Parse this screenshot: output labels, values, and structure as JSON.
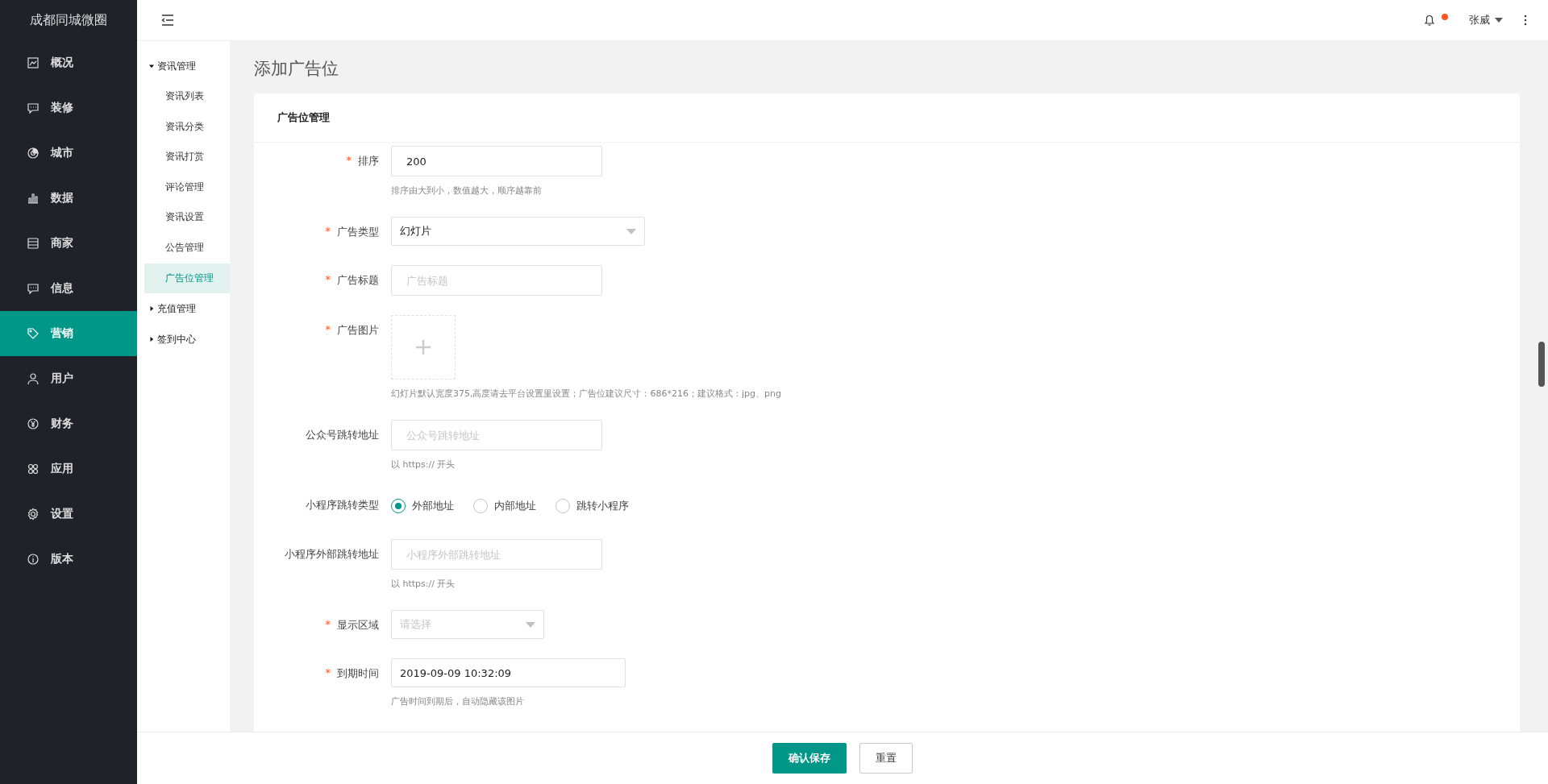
{
  "app": {
    "title": "成都同城微圈"
  },
  "sidebar": {
    "items": [
      {
        "label": "概况",
        "selected": false
      },
      {
        "label": "装修",
        "selected": false
      },
      {
        "label": "城市",
        "selected": false
      },
      {
        "label": "数据",
        "selected": false
      },
      {
        "label": "商家",
        "selected": false
      },
      {
        "label": "信息",
        "selected": false
      },
      {
        "label": "营销",
        "selected": true
      },
      {
        "label": "用户",
        "selected": false
      },
      {
        "label": "财务",
        "selected": false
      },
      {
        "label": "应用",
        "selected": false
      },
      {
        "label": "设置",
        "selected": false
      },
      {
        "label": "版本",
        "selected": false
      }
    ]
  },
  "topbar": {
    "has_unread": true,
    "user": "张威"
  },
  "submenu": {
    "groups": [
      {
        "label": "资讯管理",
        "expanded": true,
        "children": [
          {
            "label": "资讯列表",
            "selected": false
          },
          {
            "label": "资讯分类",
            "selected": false
          },
          {
            "label": "资讯打赏",
            "selected": false
          },
          {
            "label": "评论管理",
            "selected": false
          },
          {
            "label": "资讯设置",
            "selected": false
          },
          {
            "label": "公告管理",
            "selected": false
          },
          {
            "label": "广告位管理",
            "selected": true
          }
        ]
      },
      {
        "label": "充值管理",
        "expanded": false
      },
      {
        "label": "签到中心",
        "expanded": false
      }
    ]
  },
  "page": {
    "title": "添加广告位"
  },
  "card": {
    "title": "广告位管理",
    "fields": [
      {
        "kind": "input",
        "label": "排序",
        "required_mark": "*",
        "value": "200",
        "hint": "排序由大到小，数值越大，顺序越靠前"
      },
      {
        "kind": "select",
        "label": "广告类型",
        "required_mark": "*",
        "value": "幻灯片"
      },
      {
        "kind": "input",
        "label": "广告标题",
        "required_mark": "*",
        "placeholder": "广告标题"
      },
      {
        "kind": "upload",
        "label": "广告图片",
        "required_mark": "*",
        "hint": "幻灯片默认宽度375,高度请去平台设置里设置；广告位建议尺寸：686*216；建议格式：jpg、png"
      },
      {
        "kind": "input",
        "label": "公众号跳转地址",
        "placeholder": "公众号跳转地址",
        "hint": "以 https:// 开头"
      },
      {
        "kind": "radio",
        "label": "小程序跳转类型",
        "options": [
          {
            "label": "外部地址",
            "selected": true
          },
          {
            "label": "内部地址",
            "selected": false
          },
          {
            "label": "跳转小程序",
            "selected": false
          }
        ]
      },
      {
        "kind": "input",
        "label": "小程序外部跳转地址",
        "placeholder": "小程序外部跳转地址",
        "hint": "以 https:// 开头"
      },
      {
        "kind": "select",
        "label": "显示区域",
        "required_mark": "*",
        "placeholder": "请选择"
      },
      {
        "kind": "date",
        "label": "到期时间",
        "required_mark": "*",
        "value": "2019-09-09 10:32:09",
        "hint": "广告时间到期后，自动隐藏该图片"
      }
    ]
  },
  "footer": {
    "buttons": [
      {
        "label": "确认保存",
        "kind": "primary"
      },
      {
        "label": "重置",
        "kind": "default"
      }
    ]
  }
}
